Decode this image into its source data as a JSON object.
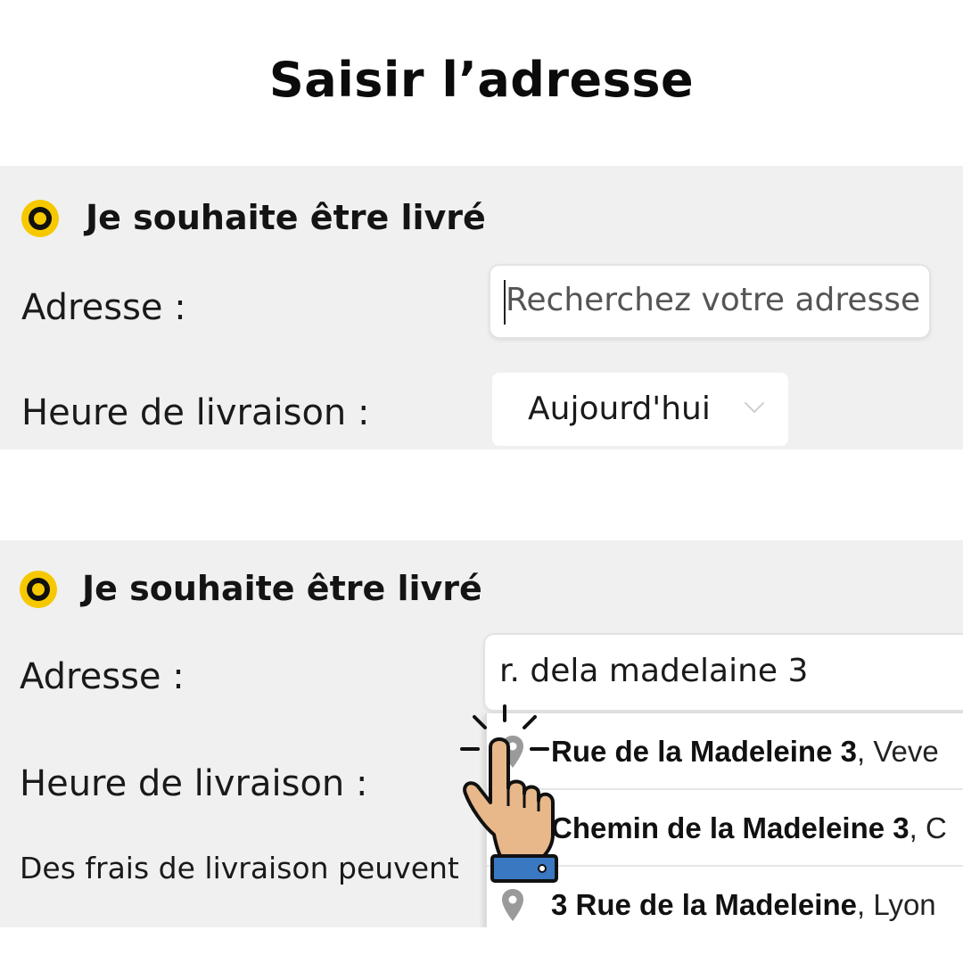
{
  "title": "Saisir l’adresse",
  "panel_before": {
    "option_label": "Je souhaite être livré",
    "address_label": "Adresse :",
    "address_placeholder": "Recherchez votre adresse",
    "delivery_time_label": "Heure de livraison :",
    "delivery_time_value": "Aujourd'hui"
  },
  "panel_after": {
    "option_label": "Je souhaite être livré",
    "address_label": "Adresse :",
    "address_value": "r. dela madelaine 3",
    "delivery_time_label": "Heure de livraison :",
    "fee_note": "Des frais de livraison peuvent",
    "suggestions": [
      {
        "street": "Rue de la Madeleine 3",
        "sep": ", ",
        "locality": "Veve"
      },
      {
        "street": "Chemin de la Madeleine 3",
        "sep": ", ",
        "locality": "C"
      },
      {
        "street": "3 Rue de la Madeleine",
        "sep": ", ",
        "locality": "Lyon"
      }
    ]
  },
  "icons": {
    "radio_selected": "radio-selected-icon",
    "suggestion_pin": "map-pin-icon",
    "pointer": "pointing-hand-icon",
    "select_chevron": "chevron-down-icon"
  },
  "colors": {
    "radio_accent": "#f6c800",
    "panel_background": "#f0f0f0",
    "hand_skin": "#e8b88a",
    "hand_cuff": "#3a78c2"
  }
}
